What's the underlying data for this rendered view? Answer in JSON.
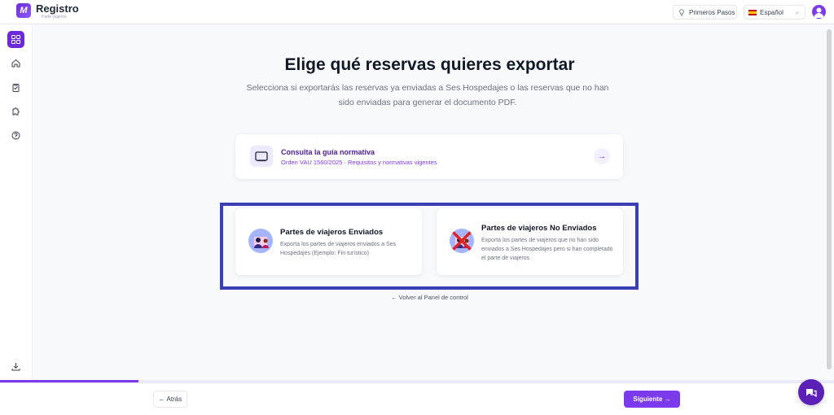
{
  "header": {
    "app_title": "Registro",
    "app_subtitle": "Parte viajeros",
    "primeros_pasos_label": "Primeros Pasos",
    "language_label": "Español"
  },
  "sidebar": {
    "items": [
      {
        "icon": "grid-icon",
        "active": true
      },
      {
        "icon": "home-icon",
        "active": false
      },
      {
        "icon": "clipboard-icon",
        "active": false
      },
      {
        "icon": "puzzle-icon",
        "active": false
      },
      {
        "icon": "help-icon",
        "active": false
      },
      {
        "icon": "download-icon",
        "active": false
      }
    ]
  },
  "main": {
    "title": "Elige qué reservas quieres exportar",
    "subtitle": "Selecciona si exportarás las reservas ya enviadas a Ses Hospedajes o las reservas que no han sido enviadas para generar el documento PDF.",
    "guide": {
      "title": "Consulta la guía normativa",
      "subtitle": "Orden VAU 1560/2025 · Requisitos y normativas vigentes",
      "arrow": "→"
    },
    "cards": {
      "sent": {
        "title": "Partes de viajeros Enviados",
        "description": "Exporta los partes de viajeros enviados a Ses Hospedajes (Ejemplo: Fin turístico)"
      },
      "not_sent": {
        "title": "Partes de viajeros No Enviados",
        "description": "Exporta los partes de viajeros que no han sido enviados a Ses Hospedajes pero si han completado el parte de viajeros"
      }
    },
    "back_link": "← Volver al Panel de control"
  },
  "footer": {
    "progress": 0.166,
    "back_label": "← Atrás",
    "next_label": "Siguiente →"
  },
  "colors": {
    "accent": "#7c3aed",
    "highlight_frame": "#3b3fb4"
  }
}
